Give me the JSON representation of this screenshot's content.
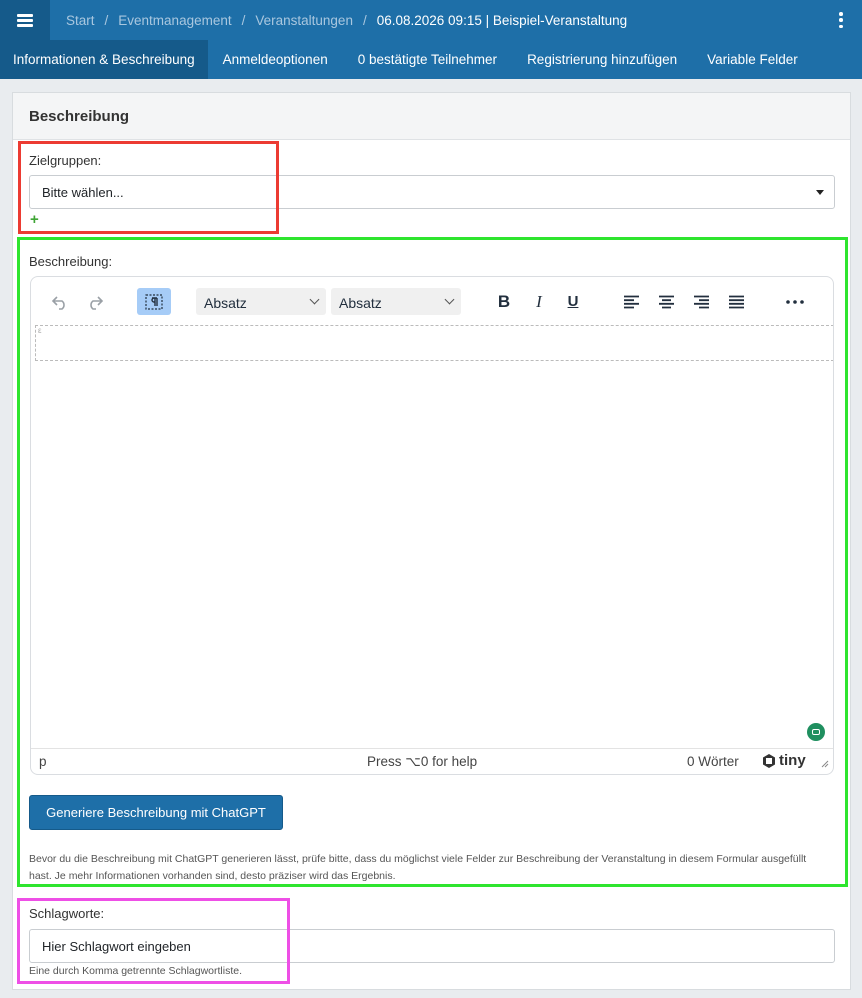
{
  "header": {
    "breadcrumb": [
      "Start",
      "Eventmanagement",
      "Veranstaltungen"
    ],
    "current": "06.08.2026 09:15 | Beispiel-Veranstaltung",
    "separator": "/"
  },
  "tabs": [
    {
      "label": "Informationen & Beschreibung",
      "active": true
    },
    {
      "label": "Anmeldeoptionen",
      "active": false
    },
    {
      "label": "0 bestätigte Teilnehmer",
      "active": false
    },
    {
      "label": "Registrierung hinzufügen",
      "active": false
    },
    {
      "label": "Variable Felder",
      "active": false
    }
  ],
  "card": {
    "title": "Beschreibung"
  },
  "zielgruppen": {
    "label": "Zielgruppen:",
    "value": "Bitte wählen...",
    "add": "+"
  },
  "description": {
    "label": "Beschreibung:",
    "format1": "Absatz",
    "format2": "Absatz",
    "content_marker": "ε",
    "status_element": "p",
    "status_help": "Press ⌥0 for help",
    "status_words": "0 Wörter",
    "brand": "tiny"
  },
  "gpt": {
    "button": "Generiere Beschreibung mit ChatGPT",
    "hint": "Bevor du die Beschreibung mit ChatGPT generieren lässt, prüfe bitte, dass du möglichst viele Felder zur Beschreibung der Veranstaltung in diesem Formular ausgefüllt hast. Je mehr Informationen vorhanden sind, desto präziser wird das Ergebnis."
  },
  "keywords": {
    "label": "Schlagworte:",
    "placeholder": "Hier Schlagwort eingeben",
    "help": "Eine durch Komma getrennte Schlagwortliste."
  },
  "colors": {
    "primary": "#1e6fa8",
    "primary_dark": "#155a8a",
    "highlight_red": "#ec3b32",
    "highlight_green": "#2ee52e",
    "highlight_pink": "#ee4fe6",
    "add_green": "#3fa535"
  }
}
